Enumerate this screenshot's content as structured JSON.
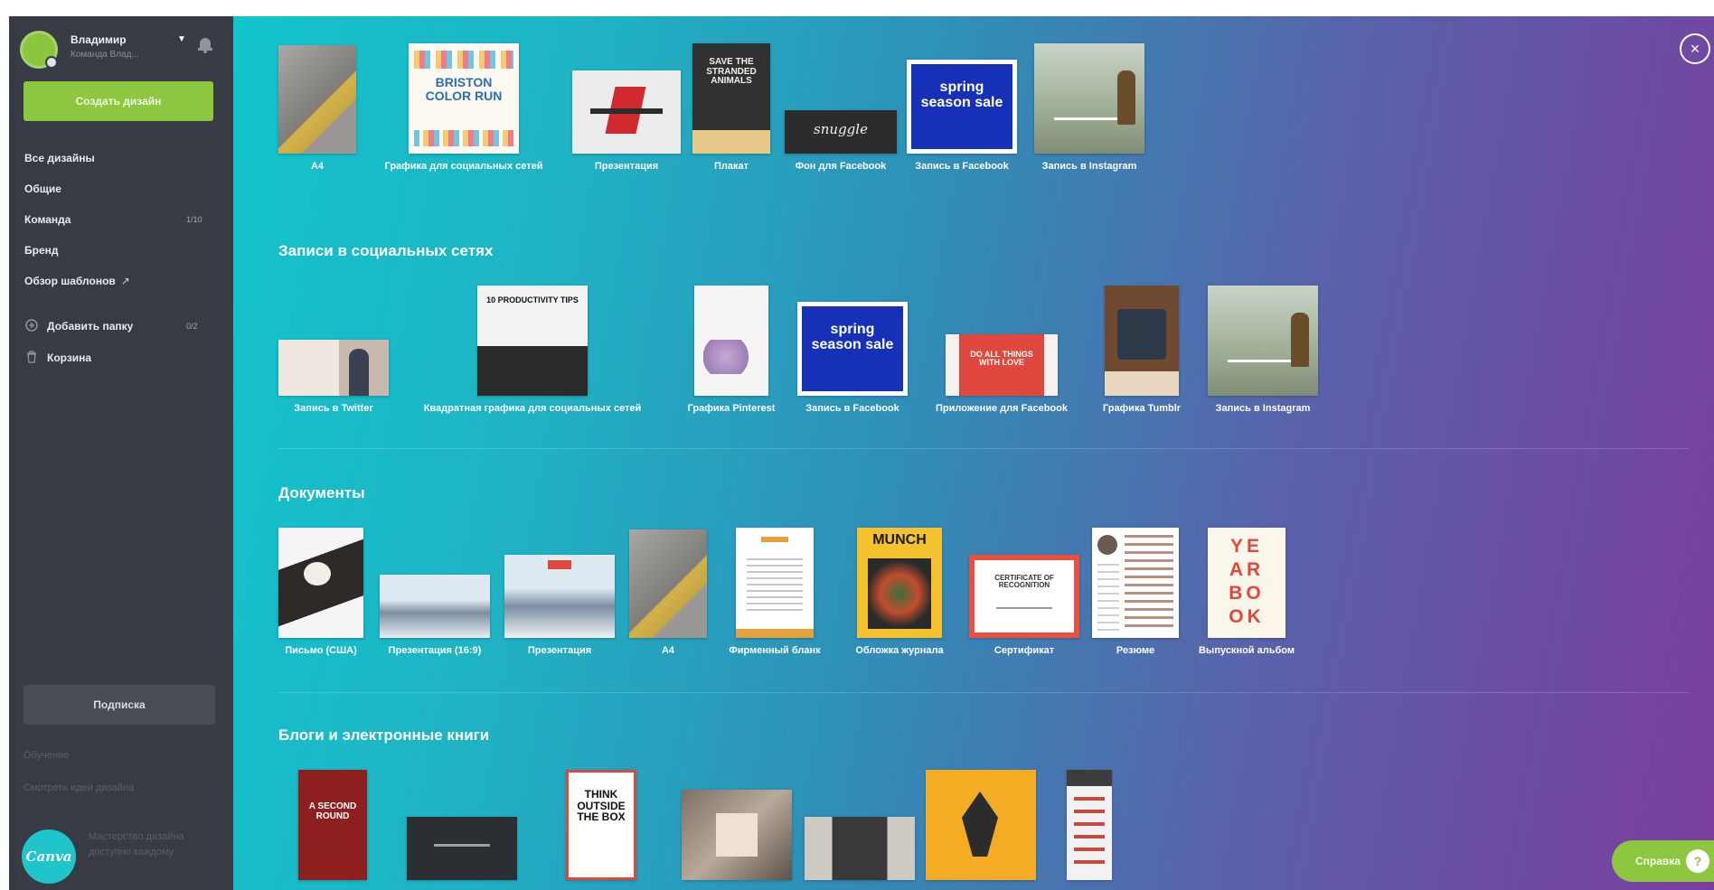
{
  "sidebar": {
    "user_name": "Владимир",
    "user_team": "Команда Влад...",
    "create_button": "Создать дизайн",
    "nav": [
      {
        "label": "Все дизайны"
      },
      {
        "label": "Общие"
      },
      {
        "label": "Команда",
        "badge": "1/10"
      },
      {
        "label": "Бренд"
      },
      {
        "label": "Обзор шаблонов",
        "suffix": "↗"
      }
    ],
    "add_folder": {
      "label": "Добавить папку",
      "badge": "0/2"
    },
    "trash": {
      "label": "Корзина"
    },
    "subscribe_button": "Подписка",
    "faint_links": [
      "Обучение",
      "Смотреть идеи дизайна"
    ],
    "logo_text": "Canva",
    "promo_text": "Мастерство дизайна доступно каждому"
  },
  "sections": [
    {
      "title": "",
      "items": [
        {
          "label": "A4"
        },
        {
          "label": "Графика для социальных сетей",
          "text": "BRISTON COLOR RUN"
        },
        {
          "label": "Презентация"
        },
        {
          "label": "Плакат",
          "text": "SAVE THE STRANDED ANIMALS"
        },
        {
          "label": "Фон для Facebook",
          "text": "snuggle"
        },
        {
          "label": "Запись в Facebook",
          "text": "spring season sale"
        },
        {
          "label": "Запись в Instagram"
        }
      ]
    },
    {
      "title": "Записи в социальных сетях",
      "items": [
        {
          "label": "Запись в Twitter"
        },
        {
          "label": "Квадратная графика для социальных сетей",
          "text": "10 PRODUCTIVITY TIPS"
        },
        {
          "label": "Графика Pinterest"
        },
        {
          "label": "Запись в Facebook",
          "text": "spring season sale"
        },
        {
          "label": "Приложение для Facebook",
          "text": "DO ALL THINGS WITH LOVE"
        },
        {
          "label": "Графика Tumblr"
        },
        {
          "label": "Запись в Instagram"
        }
      ]
    },
    {
      "title": "Документы",
      "items": [
        {
          "label": "Письмо (США)"
        },
        {
          "label": "Презентация (16:9)"
        },
        {
          "label": "Презентация"
        },
        {
          "label": "A4"
        },
        {
          "label": "Фирменный бланк"
        },
        {
          "label": "Обложка журнала",
          "text": "MUNCH"
        },
        {
          "label": "Сертификат",
          "text": "CERTIFICATE OF RECOGNITION"
        },
        {
          "label": "Резюме"
        },
        {
          "label": "Выпускной альбом",
          "text": "YE AR BO OK"
        }
      ]
    },
    {
      "title": "Блоги и электронные книги",
      "items": [
        {
          "text": "A SECOND ROUND"
        },
        {},
        {
          "text": "THINK OUTSIDE THE BOX"
        },
        {},
        {},
        {},
        {}
      ]
    }
  ],
  "help_button": "Справка",
  "help_icon": "?",
  "close_icon": "×",
  "colors": {
    "sidebar_bg": "#363b44",
    "accent_green": "#8dc63f",
    "gradient_start": "#12c4cc",
    "gradient_end": "#7a3d9e"
  }
}
